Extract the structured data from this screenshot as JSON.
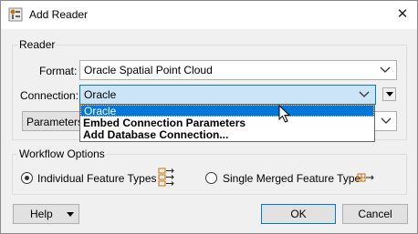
{
  "window": {
    "title": "Add Reader",
    "close_glyph": "✕"
  },
  "reader_group": {
    "legend": "Reader",
    "format_label": "Format:",
    "format_value": "Oracle Spatial Point Cloud",
    "connection_label": "Connection:",
    "connection_value": "Oracle",
    "parameters_label": "Parameters..."
  },
  "connection_dropdown": {
    "items": [
      "Oracle",
      "Embed Connection Parameters",
      "Add Database Connection..."
    ],
    "selected_index": 0
  },
  "workflow_group": {
    "legend": "Workflow Options",
    "individual_label": "Individual Feature Types",
    "merged_label": "Single Merged Feature Type",
    "selected": "Individual Feature Types"
  },
  "buttons": {
    "help": "Help",
    "ok": "OK",
    "cancel": "Cancel"
  },
  "colors": {
    "accent": "#0078d7",
    "selection_bg": "#cce4f7",
    "icon_orange": "#c87000"
  }
}
